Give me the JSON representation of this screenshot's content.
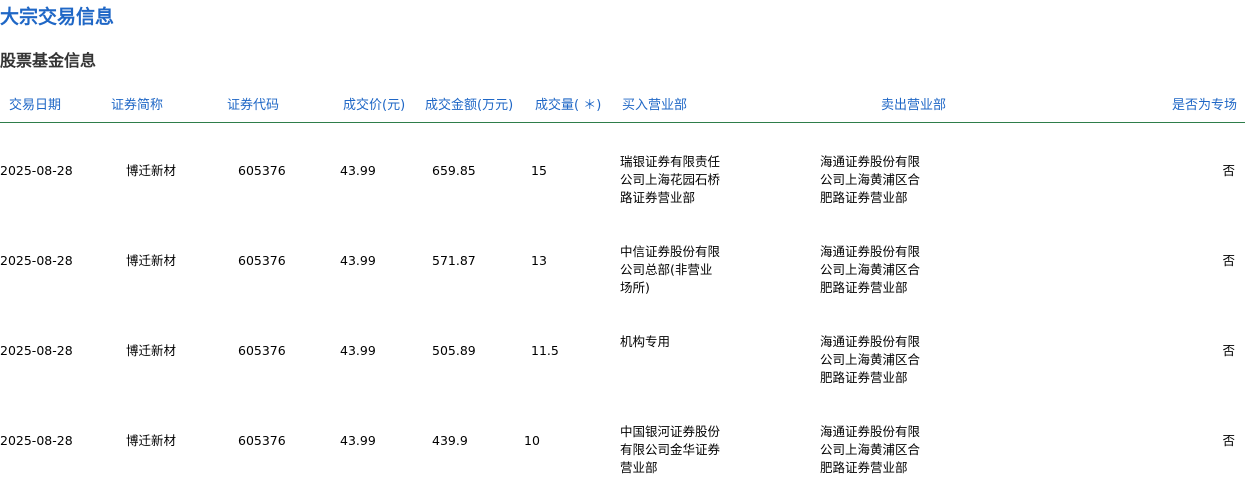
{
  "page": {
    "title": "大宗交易信息",
    "subtitle": "股票基金信息"
  },
  "table": {
    "headers": {
      "date": "交易日期",
      "name": "证券简称",
      "code": "证券代码",
      "price": "成交价(元)",
      "amount": "成交金额(万元)",
      "volume": "成交量( ＊)",
      "buyer": "买入营业部",
      "seller": "卖出营业部",
      "special": "是否为专场"
    },
    "rows": [
      {
        "date": "2025-08-28",
        "name": "博迁新材",
        "code": "605376",
        "price": "43.99",
        "amount": "659.85",
        "volume": "15",
        "buyer": "瑞银证券有限责任公司上海花园石桥路证券营业部",
        "seller": "海通证券股份有限公司上海黄浦区合肥路证券营业部",
        "special": "否"
      },
      {
        "date": "2025-08-28",
        "name": "博迁新材",
        "code": "605376",
        "price": "43.99",
        "amount": "571.87",
        "volume": "13",
        "buyer": "中信证券股份有限公司总部(非营业场所)",
        "seller": "海通证券股份有限公司上海黄浦区合肥路证券营业部",
        "special": "否"
      },
      {
        "date": "2025-08-28",
        "name": "博迁新材",
        "code": "605376",
        "price": "43.99",
        "amount": "505.89",
        "volume": "11.5",
        "buyer": "机构专用",
        "seller": "海通证券股份有限公司上海黄浦区合肥路证券营业部",
        "special": "否"
      },
      {
        "date": "2025-08-28",
        "name": "博迁新材",
        "code": "605376",
        "price": "43.99",
        "amount": "439.9",
        "volume": "10",
        "buyer": "中国银河证券股份有限公司金华证券营业部",
        "seller": "海通证券股份有限公司上海黄浦区合肥路证券营业部",
        "special": "否"
      }
    ]
  }
}
